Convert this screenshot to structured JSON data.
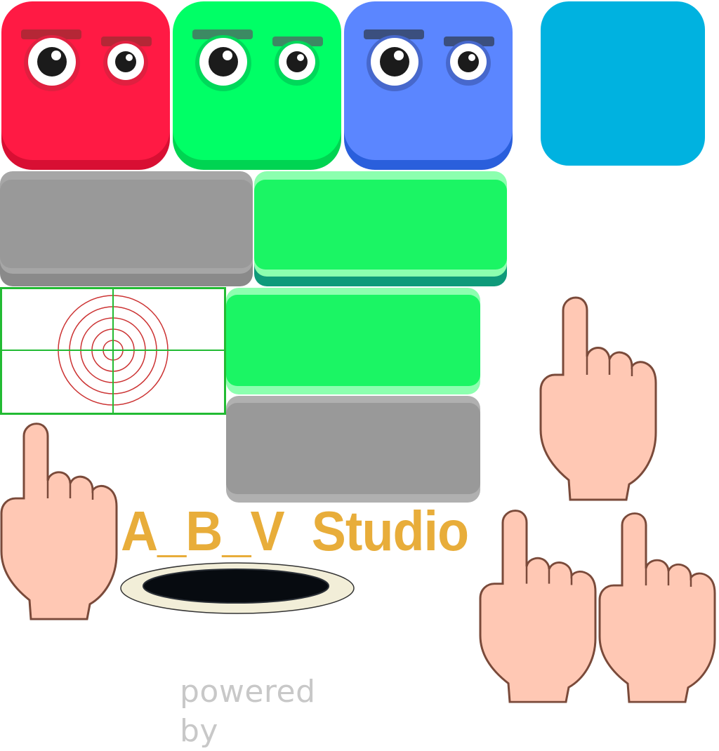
{
  "sprites": {
    "faces": [
      {
        "name": "red-face-block",
        "color": "#ff1a44",
        "shade": "#d80f33",
        "brow": "#b52736",
        "ring": "#e02040"
      },
      {
        "name": "green-face-block",
        "color": "#00ff66",
        "shade": "#00d452",
        "brow": "#3c8a63",
        "ring": "#00d85a"
      },
      {
        "name": "blue-face-block",
        "color": "#5b86ff",
        "shade": "#2a5fdc",
        "brow": "#3b4f7e",
        "ring": "#4768cc"
      }
    ],
    "plain_tile": {
      "color": "#00b2e0"
    },
    "buttons": {
      "gray": "#999999",
      "gray_shadow": "#7a7a7a",
      "green": "#1bf564",
      "green_light": "#8cffaf",
      "green_shadow": "#0f9a7a"
    },
    "target": {
      "grid_color": "#22bb33",
      "ring_color": "#cc3333"
    },
    "hand_icon": {
      "fill": "#ffc8b4",
      "stroke": "#7a4a3a"
    },
    "hole": {
      "rim": "#f2eed8",
      "pit": "#070b10"
    }
  },
  "brand": {
    "logo_text": "A_B_V  Studio",
    "powered_by": "powered by",
    "logo_color": "#e8ad3a"
  }
}
